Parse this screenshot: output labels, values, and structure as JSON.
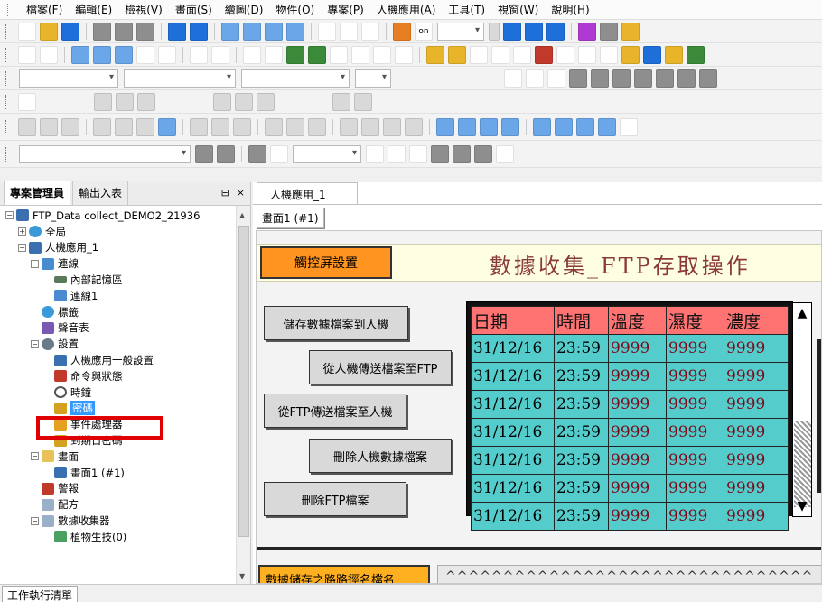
{
  "menu": {
    "items": [
      "檔案(F)",
      "編輯(E)",
      "檢視(V)",
      "畫面(S)",
      "繪圖(D)",
      "物件(O)",
      "專案(P)",
      "人機應用(A)",
      "工具(T)",
      "視窗(W)",
      "說明(H)"
    ]
  },
  "toolbar": {
    "on_off_label": "on"
  },
  "left_panel": {
    "tabs": [
      "專案管理員",
      "輸出入表"
    ],
    "pin_icon": "pin-icon",
    "close_label": "×",
    "tree": [
      {
        "label": "FTP_Data collect_DEMO2_21936",
        "level": 0,
        "exp": "minus",
        "icon": "screen"
      },
      {
        "label": "全局",
        "level": 1,
        "exp": "plus",
        "icon": "globe"
      },
      {
        "label": "人機應用_1",
        "level": 1,
        "exp": "minus",
        "icon": "screen"
      },
      {
        "label": "連線",
        "level": 2,
        "exp": "minus",
        "icon": "net"
      },
      {
        "label": "內部記憶區",
        "level": 3,
        "exp": "",
        "icon": "mem"
      },
      {
        "label": "連線1",
        "level": 3,
        "exp": "",
        "icon": "net"
      },
      {
        "label": "標籤",
        "level": 2,
        "exp": "",
        "icon": "globe"
      },
      {
        "label": "聲音表",
        "level": 2,
        "exp": "",
        "icon": "sound"
      },
      {
        "label": "設置",
        "level": 2,
        "exp": "minus",
        "icon": "gear"
      },
      {
        "label": "人機應用一般設置",
        "level": 3,
        "exp": "",
        "icon": "screen"
      },
      {
        "label": "命令與狀態",
        "level": 3,
        "exp": "",
        "icon": "alarm"
      },
      {
        "label": "時鐘",
        "level": 3,
        "exp": "",
        "icon": "clock"
      },
      {
        "label": "密碼",
        "level": 3,
        "exp": "",
        "icon": "key",
        "selected": true
      },
      {
        "label": "事件處理器",
        "level": 3,
        "exp": "",
        "icon": "bolt"
      },
      {
        "label": "到期日密碼",
        "level": 3,
        "exp": "",
        "icon": "key"
      },
      {
        "label": "畫面",
        "level": 2,
        "exp": "minus",
        "icon": "folder"
      },
      {
        "label": "畫面1 (#1)",
        "level": 3,
        "exp": "",
        "icon": "screen"
      },
      {
        "label": "警報",
        "level": 2,
        "exp": "",
        "icon": "alarm"
      },
      {
        "label": "配方",
        "level": 2,
        "exp": "",
        "icon": "recipe"
      },
      {
        "label": "數據收集器",
        "level": 2,
        "exp": "minus",
        "icon": "recipe"
      },
      {
        "label": "植物生技(0)",
        "level": 3,
        "exp": "",
        "icon": "data"
      }
    ]
  },
  "document": {
    "tab": "人機應用_1",
    "screen_tab": "畫面1 (#1)"
  },
  "screen": {
    "touch_button": "觸控屏設置",
    "title": "數據收集_FTP存取操作",
    "buttons": {
      "save_to_hmi": "儲存數據檔案到人機",
      "hmi_to_ftp": "從人機傳送檔案至FTP",
      "ftp_to_hmi": "從FTP傳送檔案至人機",
      "delete_hmi": "刪除人機數據檔案",
      "delete_ftp": "刪除FTP檔案"
    },
    "table": {
      "headers": [
        "日期",
        "時間",
        "溫度",
        "濕度",
        "濃度"
      ],
      "rows": [
        [
          "31/12/16",
          "23:59",
          "9999",
          "9999",
          "9999"
        ],
        [
          "31/12/16",
          "23:59",
          "9999",
          "9999",
          "9999"
        ],
        [
          "31/12/16",
          "23:59",
          "9999",
          "9999",
          "9999"
        ],
        [
          "31/12/16",
          "23:59",
          "9999",
          "9999",
          "9999"
        ],
        [
          "31/12/16",
          "23:59",
          "9999",
          "9999",
          "9999"
        ],
        [
          "31/12/16",
          "23:59",
          "9999",
          "9999",
          "9999"
        ],
        [
          "31/12/16",
          "23:59",
          "9999",
          "9999",
          "9999"
        ]
      ]
    },
    "scroll_up": "▲",
    "scroll_down": "▼",
    "bottom_label": "數據儲存之路路徑名檔名",
    "bottom_value": "^^^^^^^^^^^^^^^^^^^^^^^^^^^^^^^^"
  },
  "status": {
    "tab": "工作執行清單"
  },
  "colors": {
    "accent_orange": "#ff9420",
    "table_header": "#ff7373",
    "table_cell": "#55cccc",
    "value_text": "#7a0a1a",
    "selection": "#3399ff",
    "highlight_box": "#e00000"
  }
}
